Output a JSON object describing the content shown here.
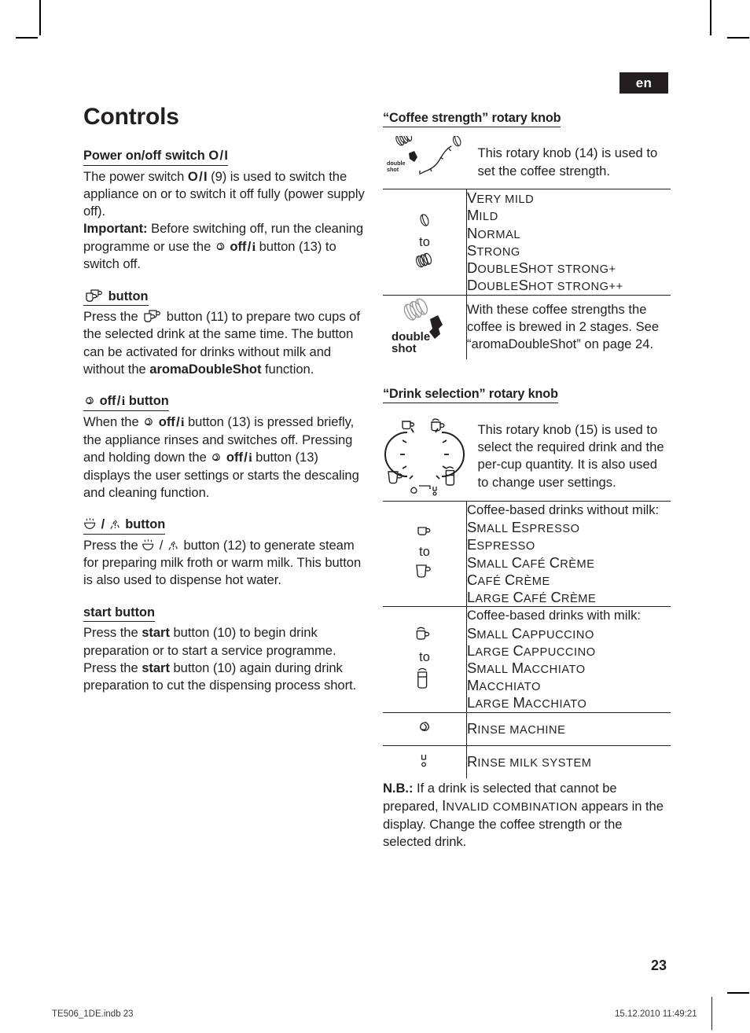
{
  "language_tab": "en",
  "page_number": "23",
  "footer": {
    "left": "TE506_1DE.indb   23",
    "right": "15.12.2010   11:49:21"
  },
  "left_column": {
    "title": "Controls",
    "sections": [
      {
        "heading": "Power on/off switch O / I",
        "paragraphs": [
          "The power switch O / I (9) is used to switch the appliance on or to switch it off fully (power supply off).",
          "Important: Before switching off, run the cleaning programme or use the off / i button (13) to switch off."
        ]
      },
      {
        "heading": "button",
        "heading_icon": "two-cups-icon",
        "paragraphs": [
          "Press the button (11) to prepare two cups of the selected drink at the same time. The button can be activated for drinks without milk and without the aromaDoubleShot function."
        ]
      },
      {
        "heading": "off / i button",
        "heading_icon": "drop-icon",
        "paragraphs": [
          "When the off / i button (13) is pressed briefly, the appliance rinses and switches off. Pressing and holding down the off / i button (13) displays the user settings or starts the descaling and cleaning function."
        ]
      },
      {
        "heading": "/ button",
        "heading_icon": "steam-warning-icon",
        "paragraphs": [
          "Press the / button (12) to generate steam for preparing milk froth or warm milk. This button is also used to dispense hot water."
        ]
      },
      {
        "heading": "start button",
        "paragraphs": [
          "Press the start button (10) to begin drink preparation or to start a service programme. Press the start button (10) again during drink preparation to cut the dispensing process short."
        ]
      }
    ]
  },
  "right_column": {
    "coffee_strength": {
      "heading": "“Coffee strength” rotary knob",
      "intro": "This rotary knob (14) is used to set the coffee strength.",
      "range_from_icon": "one-bean-icon",
      "range_to_label": "to",
      "range_to_icon": "three-beans-icon",
      "levels": [
        "Very mild",
        "Mild",
        "Normal",
        "Strong",
        "DoubleShot strong+",
        "DoubleShot strong++"
      ],
      "doubleshot_icon_label_line1": "double",
      "doubleshot_icon_label_line2": "shot",
      "doubleshot_text": "With these coffee strengths the coffee is brewed in 2 stages. See “aromaDoubleShot” on page 24."
    },
    "drink_selection": {
      "heading": "“Drink selection” rotary knob",
      "intro": "This rotary knob (15) is used to select the required drink and the per-cup quantity. It is also used to change user settings.",
      "groups": [
        {
          "from_icon": "small-cup-icon",
          "to_label": "to",
          "to_icon": "large-cup-icon",
          "caption": "Coffee-based drinks without milk:",
          "drinks": [
            "Small Espresso",
            "Espresso",
            "Small Café Crème",
            "Café Crème",
            "Large Café Crème"
          ]
        },
        {
          "from_icon": "cappuccino-cup-icon",
          "to_label": "to",
          "to_icon": "macchiato-glass-icon",
          "caption": "Coffee-based drinks with milk:",
          "drinks": [
            "Small Cappuccino",
            "Large Cappuccino",
            "Small Macchiato",
            "Macchiato",
            "Large Macchiato"
          ]
        }
      ],
      "rinse_machine": {
        "icon": "drop-icon",
        "label": "Rinse machine"
      },
      "rinse_milk": {
        "icon": "milk-system-icon",
        "label": "Rinse milk system"
      }
    },
    "note": {
      "prefix": "N.B.:",
      "text_a": " If a drink is selected that cannot be prepared, ",
      "display_text": "Invalid combination",
      "text_b": " appears in the display. Change the coffee strength or the selected drink."
    }
  }
}
